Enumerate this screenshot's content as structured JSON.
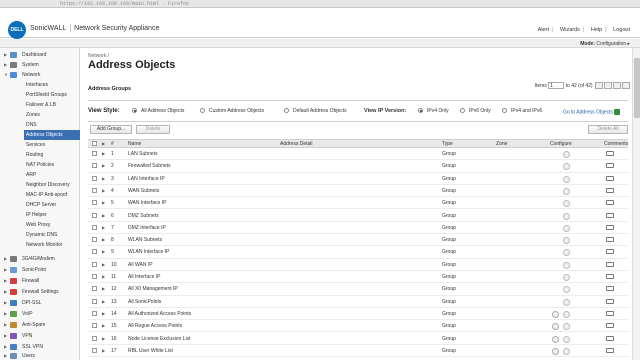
{
  "browser": {
    "url": "https://192.168.168.168/main.html · Firefox"
  },
  "header": {
    "logo": "DELL",
    "brand_left": "SonicWALL",
    "brand_right": "Network Security Appliance",
    "links": [
      "Alert",
      "Wizards",
      "Help",
      "Logout"
    ]
  },
  "modebar": {
    "label": "Mode:",
    "value": "Configuration ▸"
  },
  "sidebar": {
    "top_items": [
      {
        "label": "Dashboard",
        "color": "#5a8fd0"
      },
      {
        "label": "System",
        "color": "#7a7a7a"
      },
      {
        "label": "Network",
        "color": "#4f8bd8"
      }
    ],
    "network_sub": [
      "Interfaces",
      "PortShield Groups",
      "Failover & LB",
      "Zones",
      "DNS",
      "Address Objects",
      "Services",
      "Routing",
      "NAT Policies",
      "ARP",
      "Neighbor Discovery",
      "MAC-IP Anti-spoof",
      "DHCP Server",
      "IP Helper",
      "Web Proxy",
      "Dynamic DNS",
      "Network Monitor"
    ],
    "bottom_items": [
      {
        "label": "3G/4G/Modem",
        "color": "#7a7a7a"
      },
      {
        "label": "SonicPoint",
        "color": "#6b9bd1"
      },
      {
        "label": "Firewall",
        "color": "#d04040"
      },
      {
        "label": "Firewall Settings",
        "color": "#d04040"
      },
      {
        "label": "DPI-SSL",
        "color": "#3f7fc0"
      },
      {
        "label": "VoIP",
        "color": "#5d9d4e"
      },
      {
        "label": "Anti-Spam",
        "color": "#c08a30"
      },
      {
        "label": "VPN",
        "color": "#7a5bb0"
      },
      {
        "label": "SSL VPN",
        "color": "#4a7ec2"
      },
      {
        "label": "Users",
        "color": "#6a8fb8"
      }
    ]
  },
  "main": {
    "breadcrumb": "Network /",
    "title": "Address Objects",
    "section": "Address Groups",
    "items": {
      "label": "Items",
      "value": "1",
      "range": "to 42 (of 42)"
    },
    "view_style": {
      "label": "View Style:",
      "options": [
        "All Address Objects",
        "Custom Address Objects",
        "Default Address Objects"
      ]
    },
    "ip_version": {
      "label": "View IP Version:",
      "options": [
        "IPv4 Only",
        "IPv6 Only",
        "IPv4 and IPv6"
      ]
    },
    "goto": "Go to Address Objects",
    "buttons": {
      "add_group": "Add Group...",
      "delete": "Delete",
      "delete_all": "Delete All"
    },
    "columns": [
      "#",
      "Name",
      "Address Detail",
      "Type",
      "Zone",
      "Configure",
      "Comments"
    ],
    "rows": [
      {
        "num": "1",
        "name": "LAN Subnets",
        "type": "Group"
      },
      {
        "num": "2",
        "name": "Firewalled Subnets",
        "type": "Group"
      },
      {
        "num": "3",
        "name": "LAN Interface IP",
        "type": "Group"
      },
      {
        "num": "4",
        "name": "WAN Subnets",
        "type": "Group"
      },
      {
        "num": "5",
        "name": "WAN Interface IP",
        "type": "Group"
      },
      {
        "num": "6",
        "name": "DMZ Subnets",
        "type": "Group"
      },
      {
        "num": "7",
        "name": "DMZ Interface IP",
        "type": "Group"
      },
      {
        "num": "8",
        "name": "WLAN Subnets",
        "type": "Group"
      },
      {
        "num": "9",
        "name": "WLAN Interface IP",
        "type": "Group"
      },
      {
        "num": "10",
        "name": "All WAN IP",
        "type": "Group"
      },
      {
        "num": "11",
        "name": "All Interface IP",
        "type": "Group"
      },
      {
        "num": "12",
        "name": "All X0 Management IP",
        "type": "Group"
      },
      {
        "num": "13",
        "name": "All SonicPoints",
        "type": "Group"
      },
      {
        "num": "14",
        "name": "All Authorized Access Points",
        "type": "Group"
      },
      {
        "num": "15",
        "name": "All Rogue Access Points",
        "type": "Group"
      },
      {
        "num": "16",
        "name": "Node License Exclusion List",
        "type": "Group"
      },
      {
        "num": "17",
        "name": "RBL User White List",
        "type": "Group"
      }
    ]
  }
}
